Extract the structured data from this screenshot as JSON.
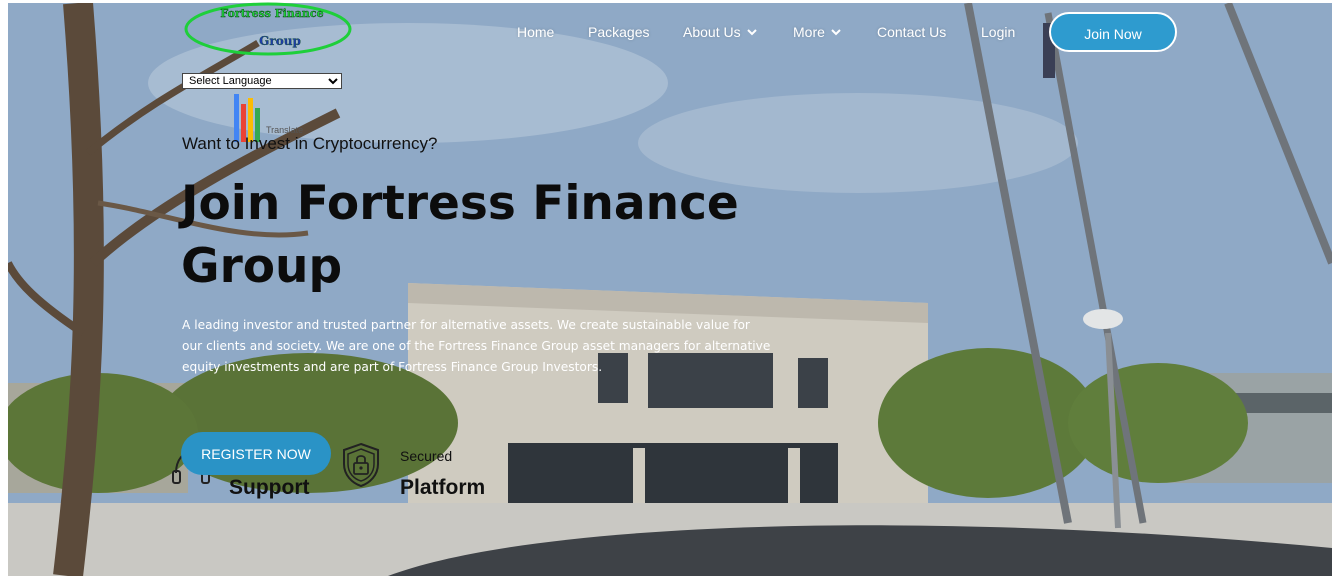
{
  "brand": {
    "line1": "Fortress Finance",
    "line2": "Group"
  },
  "language": {
    "selected": "Select Language",
    "options": [
      "Select Language"
    ],
    "translate_label": "Translate"
  },
  "nav": {
    "home": "Home",
    "packages": "Packages",
    "about": "About Us",
    "more": "More",
    "contact": "Contact Us",
    "login": "Login",
    "join": "Join Now"
  },
  "hero": {
    "eyebrow": "Want to Invest in Cryptocurrency?",
    "title": "Join Fortress Finance Group",
    "description": "A leading investor and trusted partner for alternative assets. We create sustainable value for our clients and society. We are one of the Fortress Finance Group asset managers for alternative equity investments and are part of Fortress Finance Group Investors.",
    "cta": "REGISTER NOW"
  },
  "features": {
    "support_title": "Support",
    "secured_label": "Secured",
    "platform_title": "Platform"
  },
  "colors": {
    "accent": "#2a93c6",
    "brand_green": "#1ecf3a",
    "text_dark": "#111111"
  },
  "icons": {
    "support": "headset-icon",
    "secure": "shield-lock-icon",
    "chevron": "chevron-down-icon"
  }
}
